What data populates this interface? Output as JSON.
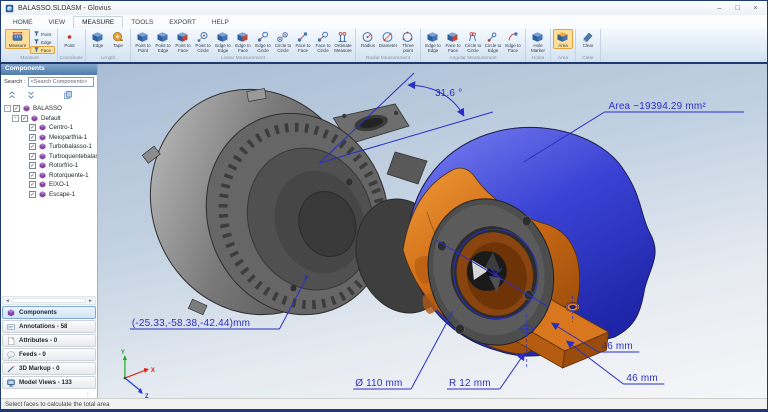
{
  "theme": {
    "annotation_blue": "#2a2fc4",
    "selection_blue": "#3a42d4",
    "part_orange": "#cf6b16",
    "housing_gray": "#5a5a5a",
    "ribbon_highlight": "#fddf9a",
    "ribbon_border": "#1e3a6e",
    "panel_header_blue": "#4f7cab"
  },
  "window": {
    "title": "BALASSO.SLDASM - Glovius",
    "controls": [
      {
        "name": "minimize",
        "glyph": "–"
      },
      {
        "name": "maximize",
        "glyph": "□"
      },
      {
        "name": "close",
        "glyph": "×"
      }
    ]
  },
  "menu": {
    "active": "MEASURE",
    "tabs": [
      {
        "label": "HOME"
      },
      {
        "label": "VIEW"
      },
      {
        "label": "MEASURE"
      },
      {
        "label": "TOOLS"
      },
      {
        "label": "EXPORT"
      },
      {
        "label": "HELP"
      }
    ]
  },
  "ribbon": {
    "groups": [
      {
        "name": "Measure",
        "layout": "measure",
        "buttons": [
          {
            "label": "Measure",
            "icon": "ruler-icon",
            "highlighted": true
          },
          {
            "label": "Point",
            "icon": "funnel-icon"
          },
          {
            "label": "Edge",
            "icon": "funnel-icon"
          },
          {
            "label": "Face",
            "icon": "funnel-icon",
            "highlighted": true
          }
        ]
      },
      {
        "name": "Coordinate",
        "buttons": [
          {
            "label": "Point",
            "icon": "dot-icon"
          }
        ]
      },
      {
        "name": "Length",
        "buttons": [
          {
            "label": "Edge",
            "icon": "cube-icon"
          },
          {
            "label": "Tape",
            "icon": "tape-icon"
          }
        ]
      },
      {
        "name": "Linear Measurement",
        "buttons": [
          {
            "label": "Point to Point",
            "icon": "cube-icon"
          },
          {
            "label": "Point to Edge",
            "icon": "cube-icon"
          },
          {
            "label": "Point to Face",
            "icon": "cube-red-icon"
          },
          {
            "label": "Point to Circle",
            "icon": "point-circle-icon"
          },
          {
            "label": "Edge to Edge",
            "icon": "cube-icon"
          },
          {
            "label": "Edge to Face",
            "icon": "cube-red-icon"
          },
          {
            "label": "Edge to Circle",
            "icon": "ball-circle-icon"
          },
          {
            "label": "Circle to Circle",
            "icon": "two-circles-icon"
          },
          {
            "label": "Face to Face",
            "icon": "two-balls-icon"
          },
          {
            "label": "Face to Circle",
            "icon": "ball-circle-icon"
          },
          {
            "label": "Ordinate Measure",
            "icon": "ordinate-icon"
          }
        ]
      },
      {
        "name": "Radial Measurement",
        "buttons": [
          {
            "label": "Radius",
            "icon": "circle-radius-icon"
          },
          {
            "label": "Diameter",
            "icon": "circle-diameter-icon"
          },
          {
            "label": "Three point circle",
            "icon": "circle-three-icon"
          }
        ]
      },
      {
        "name": "Angular Measurement",
        "buttons": [
          {
            "label": "Edge to Edge",
            "icon": "cube-icon"
          },
          {
            "label": "Face to Face",
            "icon": "cube-red-icon"
          },
          {
            "label": "Circle to Circle",
            "icon": "two-lollipops-icon"
          },
          {
            "label": "Circle to Edge",
            "icon": "lollipop-ball-icon"
          },
          {
            "label": "Edge to Face",
            "icon": "arc-ball-icon"
          }
        ]
      },
      {
        "name": "Holes",
        "buttons": [
          {
            "label": "Hole Marker",
            "icon": "cube-icon"
          }
        ]
      },
      {
        "name": "Area",
        "buttons": [
          {
            "label": "Area",
            "icon": "cube-area-icon",
            "highlighted": true
          }
        ]
      },
      {
        "name": "Clear",
        "buttons": [
          {
            "label": "Clear",
            "icon": "eraser-icon"
          }
        ]
      }
    ]
  },
  "sidebar": {
    "header": "Components",
    "search_label": "Search :",
    "search_value": "<Search Components>",
    "tools": [
      {
        "name": "collapse-all",
        "icon": "collapse-icon"
      },
      {
        "name": "expand-all",
        "icon": "expand-icon"
      },
      {
        "name": "copy",
        "icon": "copy-icon"
      }
    ],
    "tree": [
      {
        "label": "BALASSO",
        "level": 0,
        "checked": true,
        "expander": true,
        "icon": "assembly-icon"
      },
      {
        "label": "Default",
        "level": 1,
        "checked": true,
        "expander": true,
        "icon": "assembly-icon"
      },
      {
        "label": "Centro-1",
        "level": 2,
        "checked": true,
        "icon": "part-icon"
      },
      {
        "label": "Meiopartfria-1",
        "level": 2,
        "checked": true,
        "icon": "part-icon"
      },
      {
        "label": "Turbobalasso-1",
        "level": 2,
        "checked": true,
        "icon": "part-icon"
      },
      {
        "label": "Turboquentebalasso",
        "level": 2,
        "checked": true,
        "icon": "part-icon"
      },
      {
        "label": "Rotorfrio-1",
        "level": 2,
        "checked": true,
        "icon": "part-icon"
      },
      {
        "label": "Rotorquente-1",
        "level": 2,
        "checked": true,
        "icon": "part-icon"
      },
      {
        "label": "EIXO-1",
        "level": 2,
        "checked": true,
        "icon": "part-icon"
      },
      {
        "label": "Escape-1",
        "level": 2,
        "checked": true,
        "icon": "part-icon"
      }
    ],
    "hscroll": {
      "left": "◄",
      "right": "►"
    },
    "nav": [
      {
        "label": "Components",
        "icon": "components-icon",
        "active": true
      },
      {
        "label": "Annotations - 58",
        "icon": "annotations-icon"
      },
      {
        "label": "Attributes - 0",
        "icon": "attributes-icon"
      },
      {
        "label": "Feeds - 0",
        "icon": "feeds-icon"
      },
      {
        "label": "3D Markup - 0",
        "icon": "markup-icon"
      },
      {
        "label": "Model Views - 133",
        "icon": "views-icon"
      }
    ],
    "grip_glyph": "⋮"
  },
  "viewport": {
    "annotations": {
      "angle": "31.6 °",
      "area": "Area ~19394.29 mm²",
      "coordinate": "(-25.33,-58.38,-42.44)mm",
      "diameter": "Ø 110 mm",
      "radius": "R 12 mm",
      "dim1": "46 mm",
      "dim2": "46 mm"
    },
    "axis": {
      "x": "X",
      "y": "Y",
      "z": "Z"
    }
  },
  "statusbar": {
    "text": "Select faces to calculate the total area"
  }
}
